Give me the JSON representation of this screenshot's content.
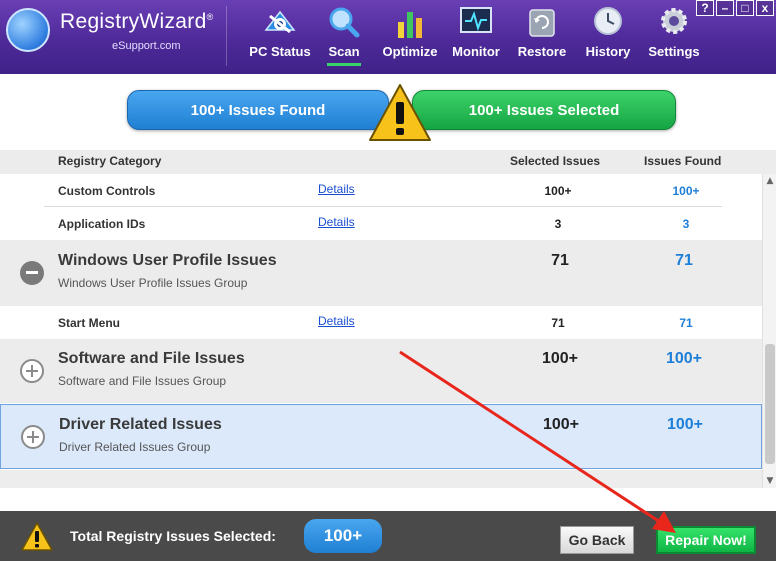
{
  "app": {
    "title": "RegistryWizard",
    "trademark": "®",
    "subtitle": "eSupport.com"
  },
  "nav": {
    "items": [
      {
        "label": "PC Status",
        "icon": "pc-status-icon"
      },
      {
        "label": "Scan",
        "icon": "scan-magnifier-icon",
        "active": true
      },
      {
        "label": "Optimize",
        "icon": "optimize-bars-icon"
      },
      {
        "label": "Monitor",
        "icon": "monitor-icon"
      },
      {
        "label": "Restore",
        "icon": "restore-drive-icon"
      },
      {
        "label": "History",
        "icon": "history-clock-icon"
      },
      {
        "label": "Settings",
        "icon": "settings-gear-icon"
      }
    ]
  },
  "window_buttons": {
    "help": "?",
    "minimize": "–",
    "maximize": "□",
    "close": "x"
  },
  "banner": {
    "issues_found": "100+ Issues Found",
    "issues_selected": "100+ Issues Selected"
  },
  "table": {
    "headers": {
      "category": "Registry Category",
      "selected": "Selected Issues",
      "found": "Issues Found"
    },
    "details_label": "Details",
    "rows": [
      {
        "type": "sub",
        "name": "Custom Controls",
        "selected": "100+",
        "found": "100+"
      },
      {
        "type": "sub",
        "name": "Application IDs",
        "selected": "3",
        "found": "3"
      },
      {
        "type": "group",
        "name": "Windows User Profile Issues",
        "subtitle": "Windows User Profile Issues Group",
        "selected": "71",
        "found": "71",
        "expanded": true
      },
      {
        "type": "sub",
        "name": "Start Menu",
        "selected": "71",
        "found": "71"
      },
      {
        "type": "group",
        "name": "Software and File Issues",
        "subtitle": "Software and File Issues Group",
        "selected": "100+",
        "found": "100+",
        "expanded": false
      },
      {
        "type": "group",
        "name": "Driver Related Issues",
        "subtitle": "Driver Related Issues Group",
        "selected": "100+",
        "found": "100+",
        "expanded": false,
        "highlighted": true
      }
    ]
  },
  "footer": {
    "total_label": "Total Registry Issues Selected:",
    "total_value": "100+",
    "go_back": "Go Back",
    "repair_now": "Repair Now!"
  },
  "colors": {
    "header_purple": "#4e2a99",
    "accent_blue": "#1f7fd2",
    "accent_green": "#15a544",
    "annotation_red": "#e8261c"
  }
}
